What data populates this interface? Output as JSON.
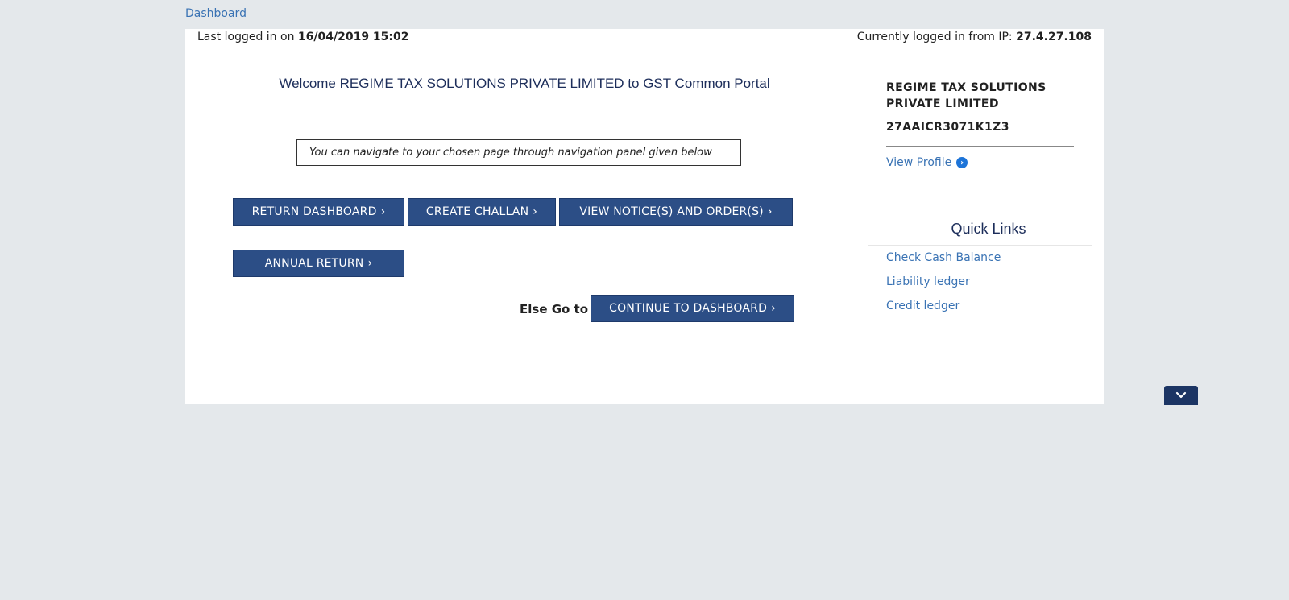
{
  "breadcrumb": {
    "label": "Dashboard"
  },
  "session": {
    "last_login_prefix": "Last logged in on",
    "last_login_value": "16/04/2019 15:02",
    "ip_prefix": "Currently logged in from IP:",
    "ip_value": "27.4.27.108"
  },
  "welcome": "Welcome REGIME TAX SOLUTIONS PRIVATE LIMITED to GST Common Portal",
  "nav_hint": "You can navigate to your chosen page through navigation panel given below",
  "buttons": {
    "return_dashboard": "RETURN DASHBOARD",
    "create_challan": "CREATE CHALLAN",
    "view_notices": "VIEW NOTICE(S) AND ORDER(S)",
    "annual_return": "ANNUAL RETURN",
    "continue_dashboard": "CONTINUE TO DASHBOARD",
    "chevron": "›"
  },
  "else_go": {
    "label": "Else Go to",
    "arrows": "»"
  },
  "profile": {
    "name": "REGIME TAX SOLUTIONS PRIVATE LIMITED",
    "gstin": "27AAICR3071K1Z3",
    "view_profile": "View Profile",
    "view_profile_icon": "›"
  },
  "quick_links": {
    "title": "Quick Links",
    "items": [
      "Check Cash Balance",
      "Liability ledger",
      "Credit ledger"
    ]
  },
  "icons": {
    "scroll_down": "chevron-down-icon"
  },
  "colors": {
    "background": "#e4e8eb",
    "button": "#2c4e86",
    "link": "#3a73b4",
    "heading": "#1c2d5a"
  }
}
